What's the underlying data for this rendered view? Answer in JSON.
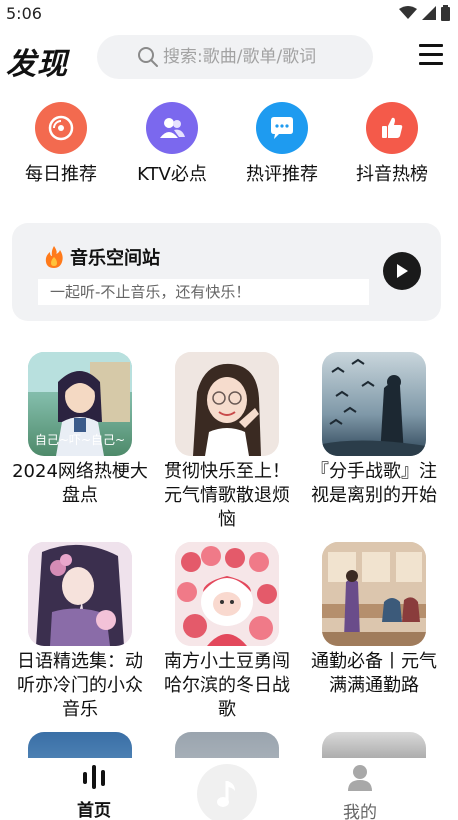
{
  "status_bar": {
    "time": "5:06"
  },
  "header": {
    "title": "发现",
    "search_placeholder": "搜索:歌曲/歌单/歌词"
  },
  "categories": [
    {
      "label": "每日推荐",
      "icon": "vinyl-record-icon",
      "color": "#f36a4f"
    },
    {
      "label": "KTV必点",
      "icon": "users-icon",
      "color": "#7b68ee"
    },
    {
      "label": "热评推荐",
      "icon": "chat-bubble-icon",
      "color": "#1e9bf0"
    },
    {
      "label": "抖音热榜",
      "icon": "thumbs-up-icon",
      "color": "#f45a4a"
    }
  ],
  "station": {
    "title": "音乐空间站",
    "subtitle": "一起听-不止音乐，还有快乐！"
  },
  "playlists": [
    {
      "caption": "2024网络热梗大盘点",
      "cover_text": "自己~吓~自己~"
    },
    {
      "caption": "贯彻快乐至上！元气情歌散退烦恼"
    },
    {
      "caption": "『分手战歌』注视是离别的开始"
    },
    {
      "caption": "日语精选集：动听亦冷门的小众音乐"
    },
    {
      "caption": "南方小土豆勇闯哈尔滨的冬日战歌"
    },
    {
      "caption": "通勤必备丨元气满满通勤路"
    }
  ],
  "bottom_nav": {
    "home_label": "首页",
    "mine_label": "我的"
  }
}
